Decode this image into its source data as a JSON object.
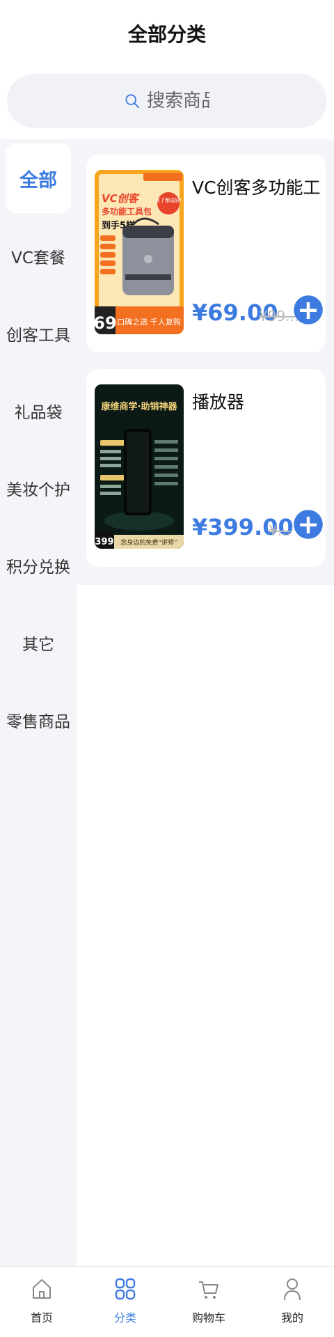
{
  "header": {
    "title": "全部分类"
  },
  "search": {
    "placeholder": "搜索商品"
  },
  "sidebar": {
    "items": [
      {
        "label": "全部",
        "active": true
      },
      {
        "label": "VC套餐",
        "active": false
      },
      {
        "label": "创客工具",
        "active": false
      },
      {
        "label": "礼品袋",
        "active": false
      },
      {
        "label": "美妆个护",
        "active": false
      },
      {
        "label": "积分兑换",
        "active": false
      },
      {
        "label": "其它",
        "active": false
      },
      {
        "label": "零售商品",
        "active": false
      }
    ]
  },
  "products": [
    {
      "title": "VC创客多功能工具包",
      "price": "¥69.00",
      "old_price": "¥99...",
      "image": {
        "headline1": "VC创客",
        "headline2": "多功能工具包",
        "sub": "到手5样",
        "badge": "有了都说好!",
        "price": "69",
        "footer": "口碑之选 千人复购"
      }
    },
    {
      "title": "播放器",
      "price": "¥399.00",
      "old_price": "¥...",
      "image": {
        "headline": "康维商学·助销神器",
        "price": "399",
        "footer": "您身边的免费“讲师”"
      }
    }
  ],
  "tabbar": {
    "items": [
      {
        "label": "首页",
        "icon": "home-icon",
        "active": false
      },
      {
        "label": "分类",
        "icon": "grid-icon",
        "active": true
      },
      {
        "label": "购物车",
        "icon": "cart-icon",
        "active": false
      },
      {
        "label": "我的",
        "icon": "user-icon",
        "active": false
      }
    ]
  },
  "colors": {
    "accent": "#3d7be0",
    "page_bg": "#f4f5f9",
    "search_bg": "#f0f2f7"
  }
}
